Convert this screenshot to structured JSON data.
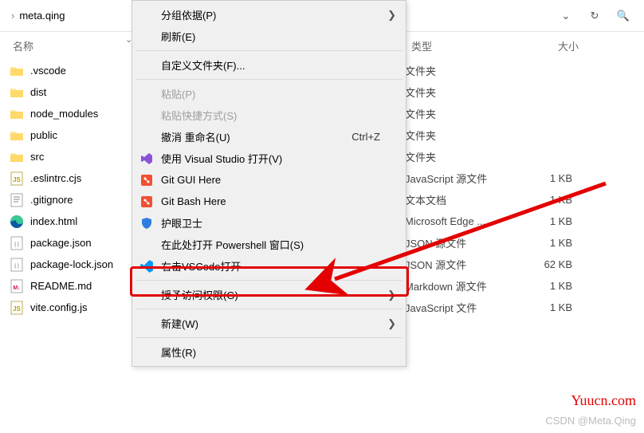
{
  "address": {
    "chevron": "›",
    "folder": "meta.qing",
    "dropdownIcon": "⌄"
  },
  "toolbar": {
    "refreshGlyph": "↻",
    "searchGlyph": "🔍"
  },
  "columns": {
    "name": "名称",
    "type": "类型",
    "size": "大小"
  },
  "files": [
    {
      "icon": "folder",
      "name": ".vscode",
      "type": "文件夹",
      "size": ""
    },
    {
      "icon": "folder",
      "name": "dist",
      "type": "文件夹",
      "size": ""
    },
    {
      "icon": "folder",
      "name": "node_modules",
      "type": "文件夹",
      "size": ""
    },
    {
      "icon": "folder",
      "name": "public",
      "type": "文件夹",
      "size": ""
    },
    {
      "icon": "folder",
      "name": "src",
      "type": "文件夹",
      "size": ""
    },
    {
      "icon": "js",
      "name": ".eslintrc.cjs",
      "type": "JavaScript 源文件",
      "size": "1 KB"
    },
    {
      "icon": "txt",
      "name": ".gitignore",
      "type": "文本文档",
      "size": "1 KB"
    },
    {
      "icon": "edge",
      "name": "index.html",
      "type": "Microsoft Edge ...",
      "size": "1 KB"
    },
    {
      "icon": "json",
      "name": "package.json",
      "type": "JSON 源文件",
      "size": "1 KB"
    },
    {
      "icon": "json",
      "name": "package-lock.json",
      "type": "JSON 源文件",
      "size": "62 KB"
    },
    {
      "icon": "md",
      "name": "README.md",
      "type": "Markdown 源文件",
      "size": "1 KB"
    },
    {
      "icon": "js",
      "name": "vite.config.js",
      "type": "JavaScript 文件",
      "size": "1 KB"
    }
  ],
  "menu": {
    "groupBy": "分组依据(P)",
    "refresh": "刷新(E)",
    "customize": "自定义文件夹(F)...",
    "paste": "粘贴(P)",
    "pasteShortcut": "粘贴快捷方式(S)",
    "undoRename": "撤消 重命名(U)",
    "undoShortcut": "Ctrl+Z",
    "openVS": "使用 Visual Studio 打开(V)",
    "gitGui": "Git GUI Here",
    "gitBash": "Git Bash Here",
    "guard": "护眼卫士",
    "powershell": "在此处打开 Powershell 窗口(S)",
    "vscode": "右击VSCode打开",
    "grantAccess": "授予访问权限(G)",
    "new": "新建(W)",
    "properties": "属性(R)",
    "arrowGlyph": "❯"
  },
  "watermark": {
    "site": "Yuucn.com",
    "csdn": "CSDN @Meta.Qing"
  }
}
